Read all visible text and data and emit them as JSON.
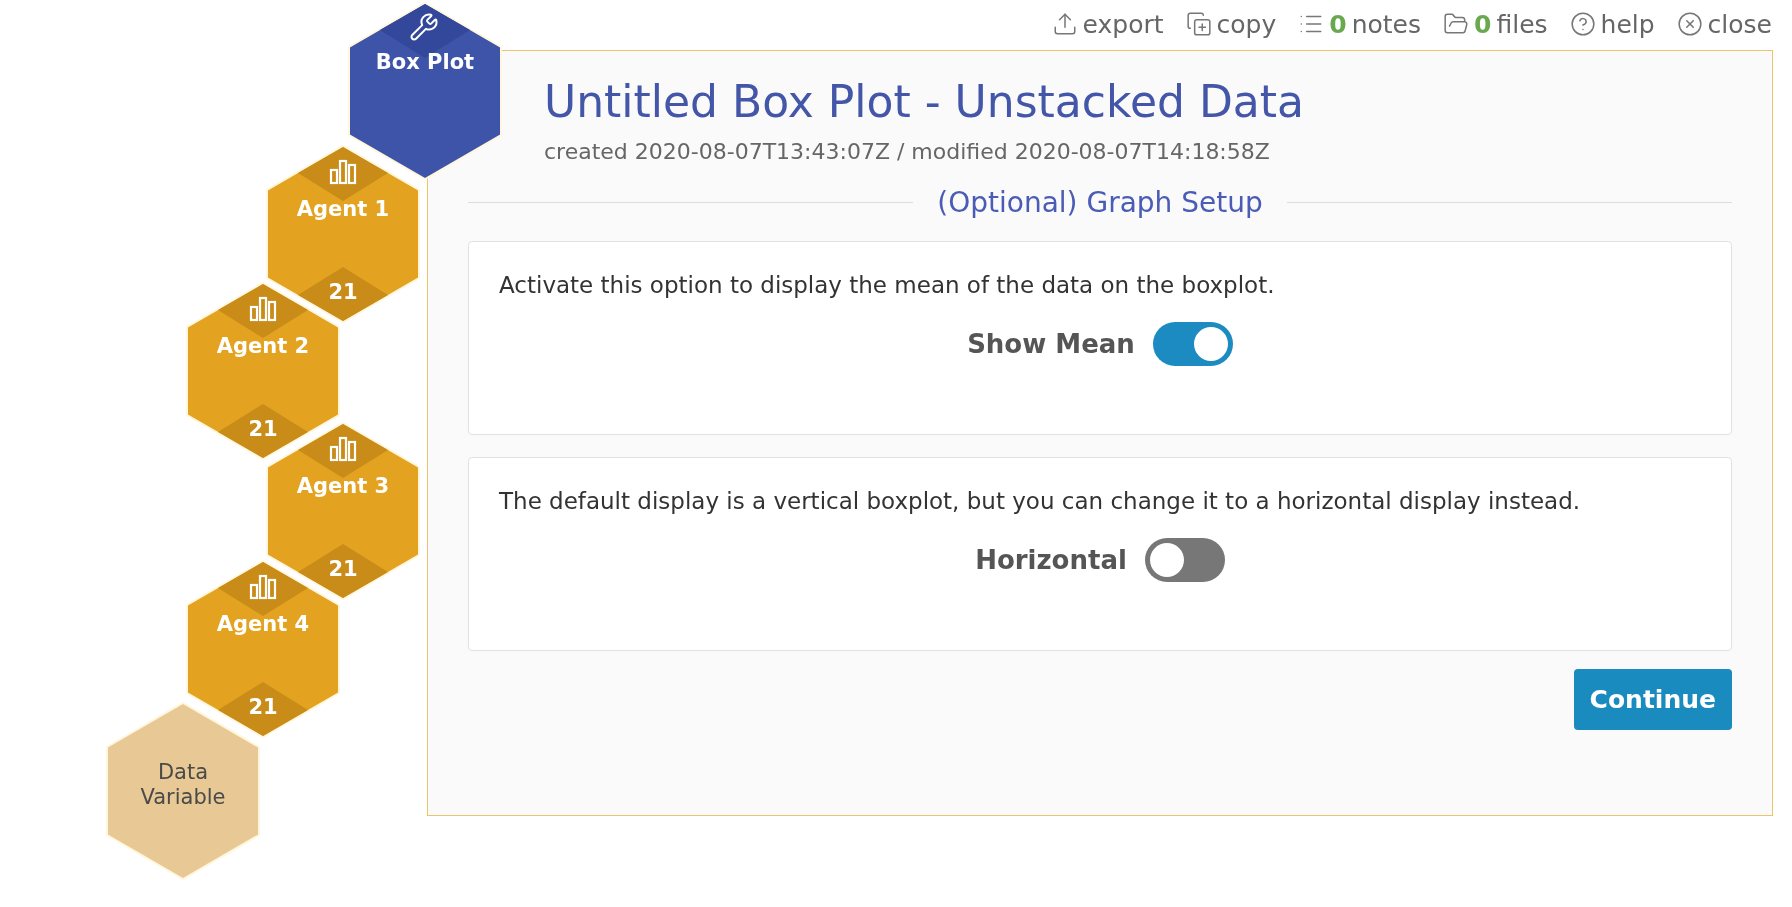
{
  "toolbar": [
    {
      "kind": "export",
      "label": "export"
    },
    {
      "kind": "copy",
      "label": "copy"
    },
    {
      "kind": "notes",
      "count": "0",
      "label": "notes"
    },
    {
      "kind": "files",
      "count": "0",
      "label": "files"
    },
    {
      "kind": "help",
      "label": "help"
    },
    {
      "kind": "close",
      "label": "close"
    }
  ],
  "workflow": [
    {
      "kind": "tool",
      "label": "Box Plot"
    },
    {
      "kind": "variable",
      "label": "Agent 1",
      "count": "21"
    },
    {
      "kind": "variable",
      "label": "Agent 2",
      "count": "21"
    },
    {
      "kind": "variable",
      "label": "Agent 3",
      "count": "21"
    },
    {
      "kind": "variable",
      "label": "Agent 4",
      "count": "21"
    },
    {
      "kind": "data",
      "label": "Data Variable"
    }
  ],
  "panel": {
    "title": "Untitled Box Plot - Unstacked Data",
    "meta": "created 2020-08-07T13:43:07Z / modified 2020-08-07T14:18:58Z",
    "section": "(Optional) Graph Setup",
    "options": [
      {
        "description": "Activate this option to display the mean of the data on the boxplot.",
        "label": "Show Mean",
        "on": true
      },
      {
        "description": "The default display is a vertical boxplot, but you can change it to a horizontal display instead.",
        "label": "Horizontal",
        "on": false
      }
    ],
    "continue_button": "Continue"
  }
}
